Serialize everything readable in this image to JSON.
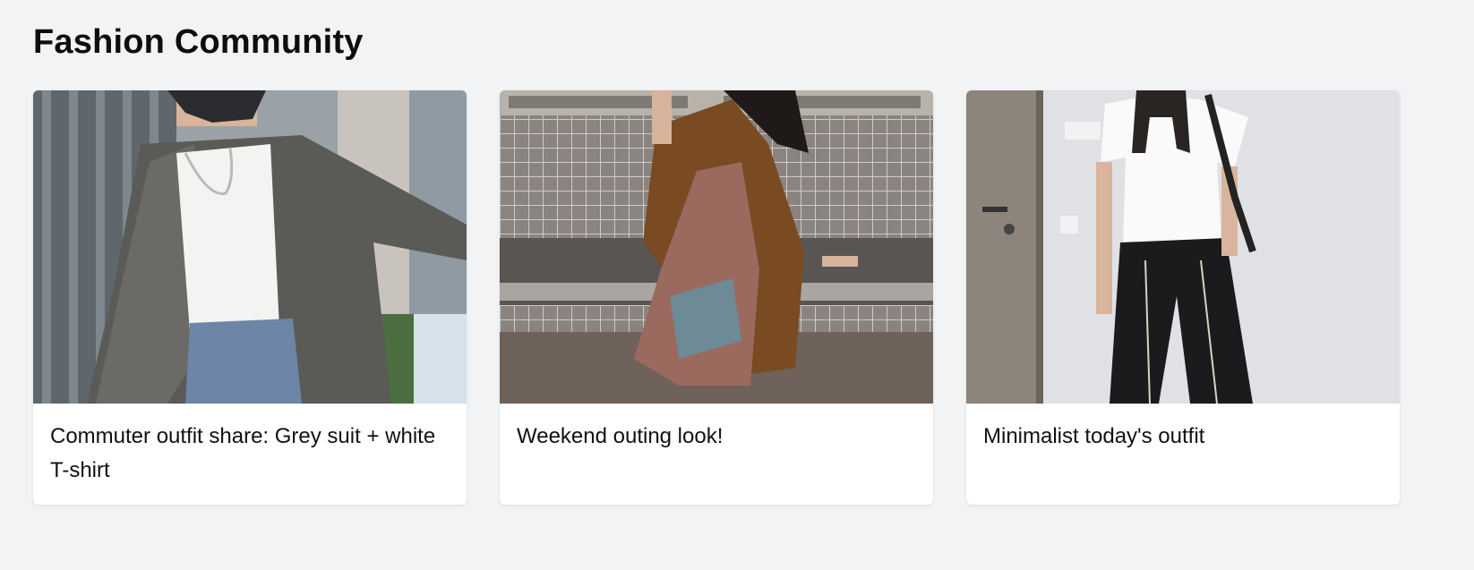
{
  "page": {
    "title": "Fashion Community"
  },
  "posts": [
    {
      "caption": "Commuter outfit share: Grey suit + white T-shirt",
      "image_icon": "photo-grey-suit-street"
    },
    {
      "caption": "Weekend outing look!",
      "image_icon": "photo-brown-jacket-bench"
    },
    {
      "caption": "Minimalist today's outfit",
      "image_icon": "photo-white-tee-black-pants"
    }
  ],
  "colors": {
    "background": "#f2f3f5",
    "card": "#ffffff",
    "text": "#111111"
  }
}
